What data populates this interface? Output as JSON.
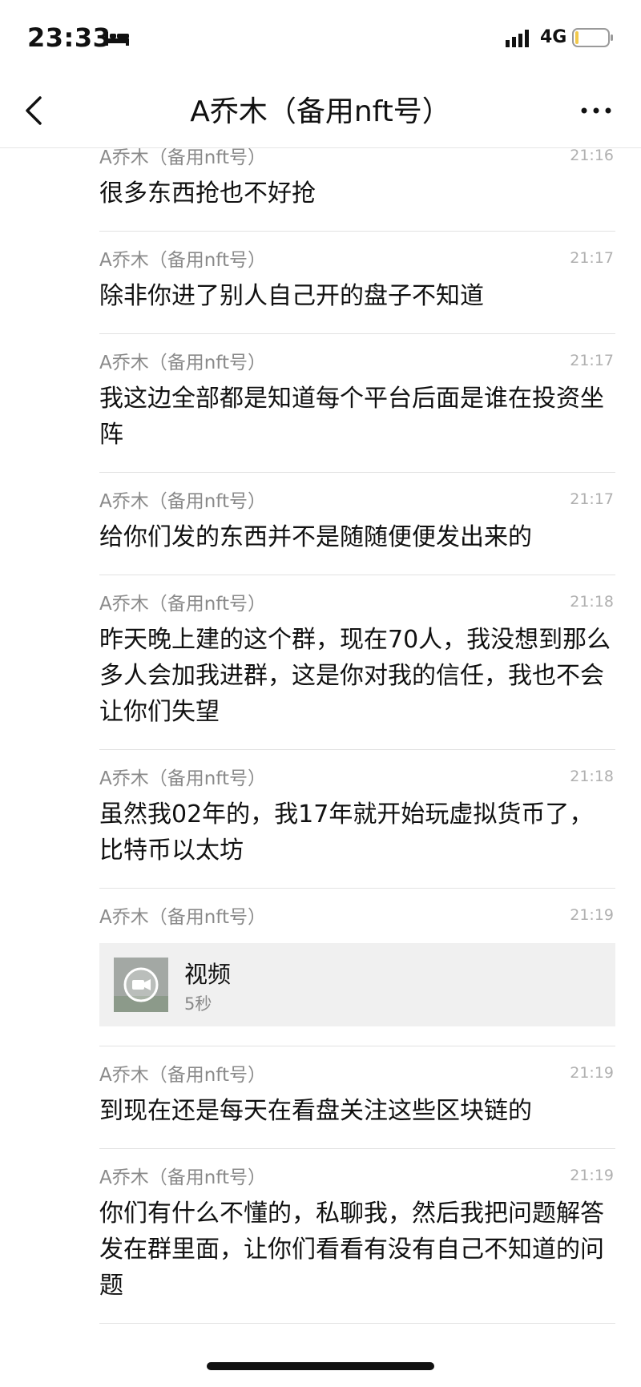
{
  "status_bar": {
    "time": "23:33",
    "network": "4G",
    "bed_icon": "bed-icon",
    "signal_icon": "signal-icon",
    "battery_icon": "battery-icon"
  },
  "nav": {
    "title": "A乔木（备用nft号）",
    "back_icon": "chevron-left-icon",
    "more_icon": "more-icon"
  },
  "messages": [
    {
      "sender": "A乔木（备用nft号）",
      "time": "21:16",
      "text": "很多东西抢也不好抢"
    },
    {
      "sender": "A乔木（备用nft号）",
      "time": "21:17",
      "text": "除非你进了别人自己开的盘子不知道"
    },
    {
      "sender": "A乔木（备用nft号）",
      "time": "21:17",
      "text": "我这边全部都是知道每个平台后面是谁在投资坐阵"
    },
    {
      "sender": "A乔木（备用nft号）",
      "time": "21:17",
      "text": "给你们发的东西并不是随随便便发出来的"
    },
    {
      "sender": "A乔木（备用nft号）",
      "time": "21:18",
      "text": "昨天晚上建的这个群，现在70人，我没想到那么多人会加我进群，这是你对我的信任，我也不会让你们失望"
    },
    {
      "sender": "A乔木（备用nft号）",
      "time": "21:18",
      "text": "虽然我02年的，我17年就开始玩虚拟货币了，比特币以太坊"
    },
    {
      "sender": "A乔木（备用nft号）",
      "time": "21:19",
      "video": {
        "title": "视频",
        "duration": "5秒",
        "icon": "video-camera-icon"
      }
    },
    {
      "sender": "A乔木（备用nft号）",
      "time": "21:19",
      "text": "到现在还是每天在看盘关注这些区块链的"
    },
    {
      "sender": "A乔木（备用nft号）",
      "time": "21:19",
      "text": "你们有什么不懂的，私聊我，然后我把问题解答发在群里面，让你们看看有没有自己不知道的问题"
    }
  ]
}
